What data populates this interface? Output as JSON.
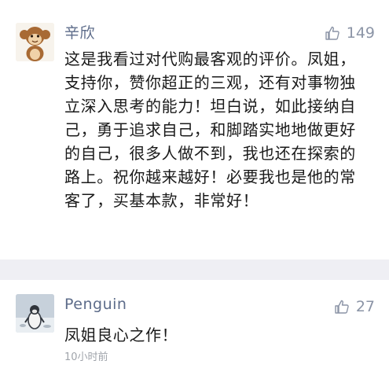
{
  "comments": [
    {
      "author": "辛欣",
      "likes": "149",
      "avatar_icon": "monkey-avatar",
      "content": "这是我看过对代购最客观的评价。凤姐，支持你，赞你超正的三观，还有对事物独立深入思考的能力！坦白说，如此接纳自己，勇于追求自己，和脚踏实地地做更好的自己，很多人做不到，我也还在探索的路上。祝你越来越好！必要我也是他的常客了，买基本款，非常好！"
    },
    {
      "author": "Penguin",
      "likes": "27",
      "avatar_icon": "penguin-avatar",
      "content": "凤姐良心之作！",
      "time": "10小时前"
    }
  ],
  "colors": {
    "name": "#5d6c8a",
    "like": "#8b94a6",
    "background": "#efeff4"
  }
}
